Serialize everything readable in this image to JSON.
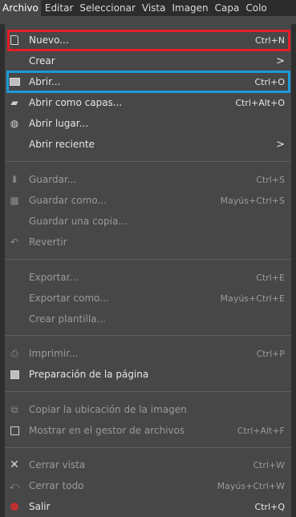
{
  "menubar": {
    "items": [
      {
        "label": "Archivo",
        "active": true
      },
      {
        "label": "Editar"
      },
      {
        "label": "Seleccionar"
      },
      {
        "label": "Vista"
      },
      {
        "label": "Imagen"
      },
      {
        "label": "Capa"
      },
      {
        "label": "Colo"
      }
    ]
  },
  "menu": {
    "nuevo": {
      "label": "Nuevo...",
      "shortcut": "Ctrl+N",
      "icon": "new-document-icon"
    },
    "crear": {
      "label": "Crear",
      "arrow": ">"
    },
    "abrir": {
      "label": "Abrir...",
      "shortcut": "Ctrl+O",
      "icon": "open-image-icon"
    },
    "abrir_capas": {
      "label": "Abrir como capas...",
      "shortcut": "Ctrl+Alt+O",
      "icon": "open-layers-icon"
    },
    "abrir_lugar": {
      "label": "Abrir lugar...",
      "icon": "globe-icon"
    },
    "abrir_reciente": {
      "label": "Abrir reciente",
      "arrow": ">"
    },
    "guardar": {
      "label": "Guardar...",
      "shortcut": "Ctrl+S",
      "icon": "save-icon"
    },
    "guardar_como": {
      "label": "Guardar como...",
      "shortcut": "Mayús+Ctrl+S",
      "icon": "save-as-icon"
    },
    "guardar_copia": {
      "label": "Guardar una copia..."
    },
    "revertir": {
      "label": "Revertir",
      "icon": "revert-icon"
    },
    "exportar": {
      "label": "Exportar...",
      "shortcut": "Ctrl+E"
    },
    "exportar_como": {
      "label": "Exportar como...",
      "shortcut": "Mayús+Ctrl+E"
    },
    "crear_plantilla": {
      "label": "Crear plantilla..."
    },
    "imprimir": {
      "label": "Imprimir...",
      "shortcut": "Ctrl+P",
      "icon": "printer-icon"
    },
    "preparacion": {
      "label": "Preparación de la página",
      "icon": "page-setup-icon"
    },
    "copiar_ubicacion": {
      "label": "Copiar la ubicación de la imagen",
      "icon": "copy-location-icon"
    },
    "mostrar_gestor": {
      "label": "Mostrar en el gestor de archivos",
      "shortcut": "Ctrl+Alt+F",
      "icon": "file-manager-icon"
    },
    "cerrar_vista": {
      "label": "Cerrar vista",
      "shortcut": "Ctrl+W",
      "icon": "close-icon"
    },
    "cerrar_todo": {
      "label": "Cerrar todo",
      "shortcut": "Mayús+Ctrl+W",
      "icon": "close-all-icon"
    },
    "salir": {
      "label": "Salir",
      "shortcut": "Ctrl+Q",
      "icon": "quit-icon"
    }
  },
  "colors": {
    "highlight_red": "#e31e28",
    "highlight_blue": "#1b9ad8",
    "menu_bg": "#474747"
  }
}
